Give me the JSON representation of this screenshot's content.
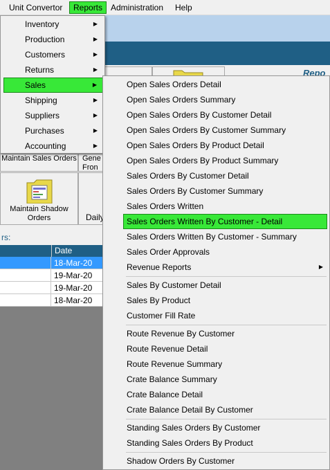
{
  "menubar": {
    "items": [
      "Unit Convertor",
      "Reports",
      "Administration",
      "Help"
    ]
  },
  "app": {
    "report_title": "Repo",
    "tiles": {
      "maintain_sales_orders": "Maintain Sales Orders",
      "gene_from": "Gene Fron",
      "maintain_shadow_orders": "Maintain Shadow Orders",
      "daily": "Daily"
    },
    "link_text": "rs:",
    "grid": {
      "date_header": "Date",
      "dates": [
        "18-Mar-20",
        "19-Mar-20",
        "19-Mar-20",
        "18-Mar-20"
      ]
    }
  },
  "reports_menu": {
    "items": [
      "Inventory",
      "Production",
      "Customers",
      "Returns",
      "Sales",
      "Shipping",
      "Suppliers",
      "Purchases",
      "Accounting"
    ],
    "active": "Sales"
  },
  "sales_menu": {
    "items": [
      "Open Sales Orders Detail",
      "Open Sales Orders Summary",
      "Open Sales Orders By Customer Detail",
      "Open Sales Orders By Customer Summary",
      "Open Sales Orders By Product Detail",
      "Open Sales Orders By Product Summary",
      "Sales Orders By Customer Detail",
      "Sales Orders By Customer Summary",
      "Sales Orders Written",
      "Sales Orders Written By Customer - Detail",
      "Sales Orders Written By Customer - Summary",
      "Sales Order Approvals",
      "Revenue Reports",
      "Sales By Customer Detail",
      "Sales By Product",
      "Customer Fill Rate",
      "Route Revenue By Customer",
      "Route Revenue Detail",
      "Route Revenue Summary",
      "Crate Balance Summary",
      "Crate Balance Detail",
      "Crate Balance Detail By Customer",
      "Standing Sales Orders By Customer",
      "Standing Sales Orders By Product",
      "Shadow Orders By Customer"
    ],
    "active": "Sales Orders Written By Customer - Detail"
  },
  "colors": {
    "highlight": "#38e838",
    "header_band": "#1f5f85",
    "selection": "#3399ff"
  }
}
